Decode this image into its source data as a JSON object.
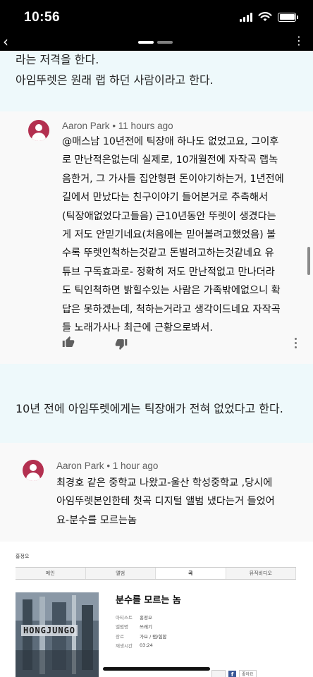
{
  "status_bar": {
    "time": "10:56"
  },
  "nav": {
    "back_icon": "‹"
  },
  "article": {
    "para1_line1": "라는 저격을 한다.",
    "para1_line2": "아임뚜렛은 원래 랩 하던 사람이라고 한다.",
    "para2": "10년 전에 아임뚜렛에게는 틱장애가 전혀 없었다고 한다."
  },
  "comment1": {
    "author": "Aaron Park",
    "time": "11 hours ago",
    "lines": [
      "@매스남 10년전에 틱장애 하나도 없었고요, 그이후",
      "로 만난적은없는데 실제로, 10개월전에 자작곡 랩녹",
      "음한거, 그 가사들 집안형편 돈이야기하는거, 1년전에",
      "길에서 만났다는 친구이야기 들어본거로 추측해서",
      "(틱장애없었다고들음) 근10년동안 뚜렛이 생겼다는",
      "게 저도 안믿기네요(처음에는 믿어볼려고했었음) 볼",
      "수록 뚜렛인척하는것같고 돈벌려고하는것같네요 유",
      "튜브 구독효과로- 정확히 저도 만난적없고 만나더라",
      "도 틱인척하면 밝힐수있는 사람은 가족밖에없으니 확",
      "답은 못하겠는데, 척하는거라고 생각이드네요 자작곡",
      "들 노래가사나 최근에 근황으로봐서."
    ]
  },
  "comment2": {
    "author": "Aaron Park",
    "time": "1 hour ago",
    "lines": [
      "최경호 같은 중학교 나왔고-울산 학성중학교 ,당시에",
      "아임뚜렛본인한테 첫곡 디지털 앨범 냈다는거 들었어",
      "요-분수를 모르는놈"
    ]
  },
  "album": {
    "artist": "홍정오",
    "tabs": [
      "메인",
      "앨범",
      "곡",
      "뮤직비디오"
    ],
    "cover_text": "HONGJUNGO",
    "song_title": "분수를 모르는 놈",
    "info": [
      {
        "key": "아티스트",
        "value": "홍정오"
      },
      {
        "key": "앨범명",
        "value": "쓰레기"
      },
      {
        "key": "장르",
        "value": "가요 / 랩/힙합"
      },
      {
        "key": "재생시간",
        "value": "03:24"
      }
    ],
    "fb_label": "f",
    "like_label": "좋아요"
  },
  "colors": {
    "page_bg": "#eef9fb",
    "comment_bg": "#f9f9f9",
    "avatar": "#b33050"
  }
}
